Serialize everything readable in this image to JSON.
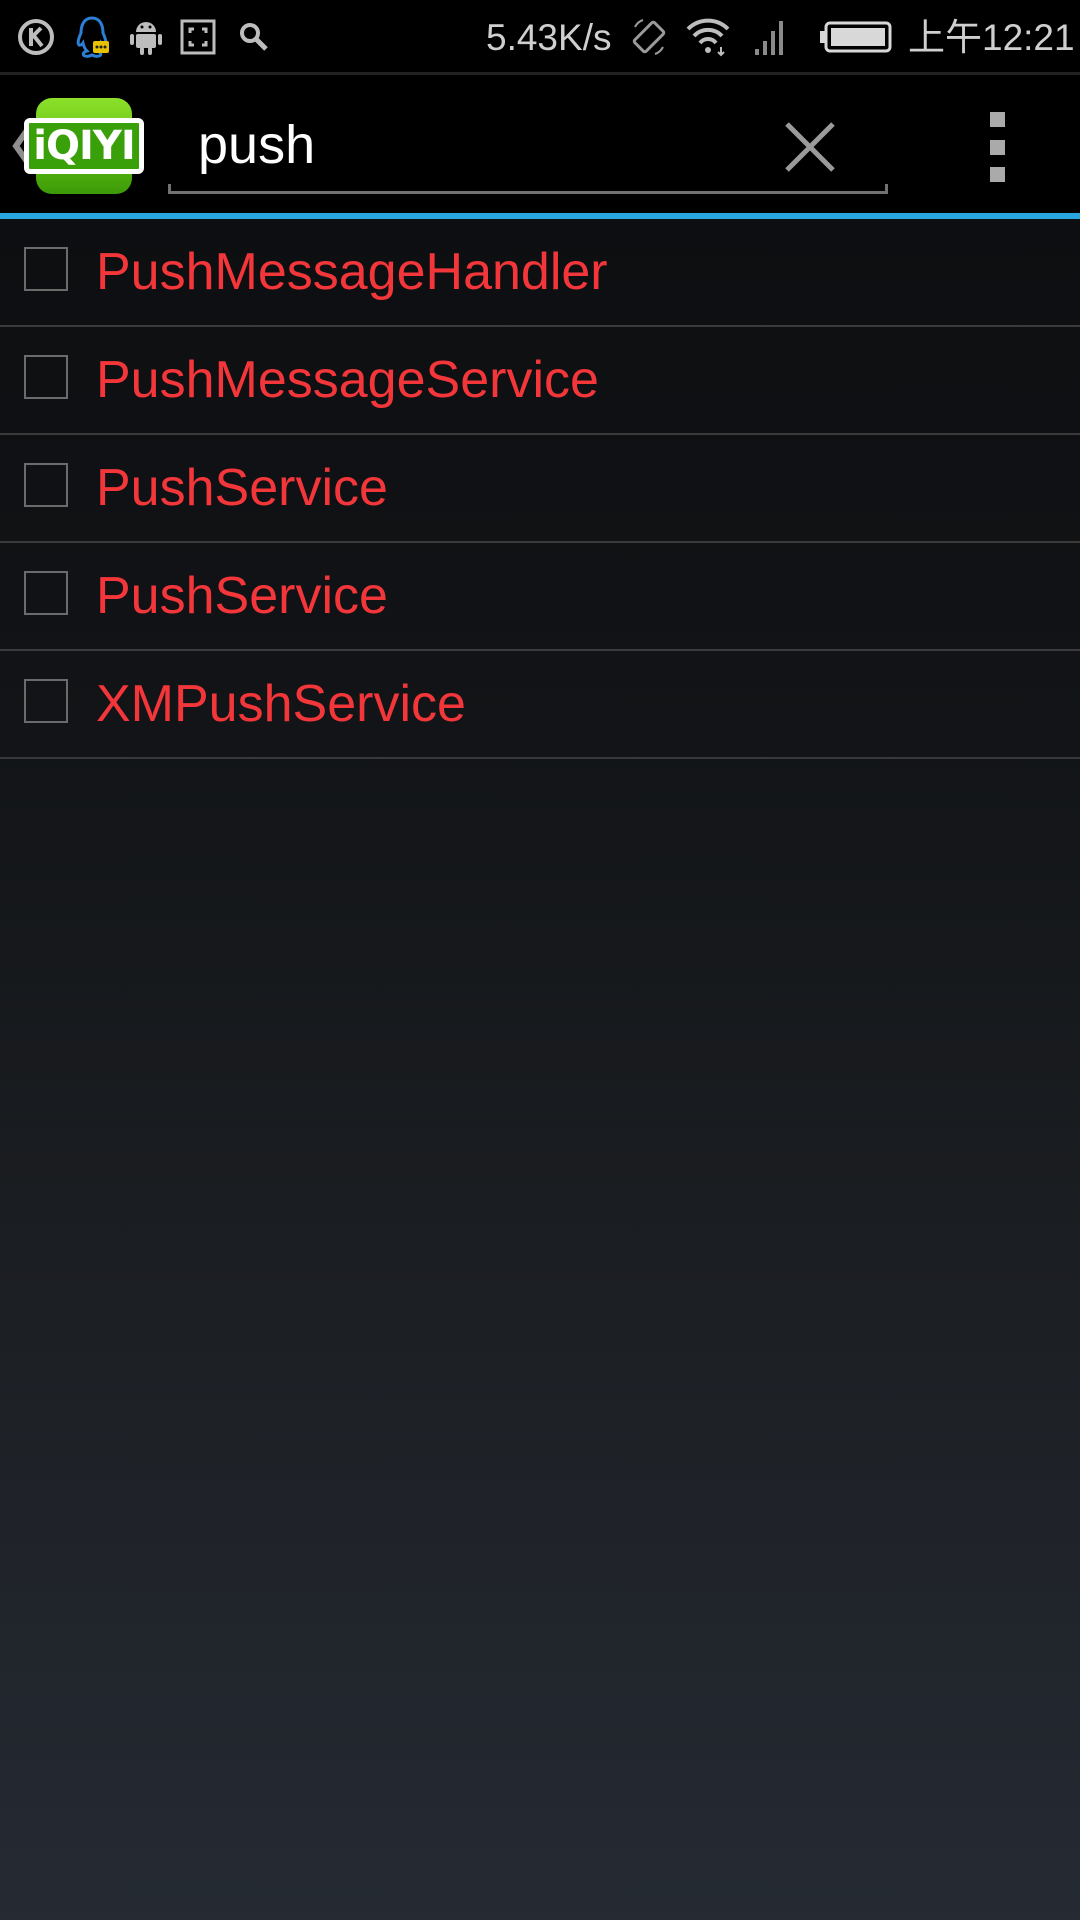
{
  "status_bar": {
    "network_speed": "5.43K/s",
    "time": "上午12:21",
    "icons": [
      "k-circle-icon",
      "qq-icon",
      "android-icon",
      "screenshot-icon",
      "search-icon",
      "rotate-icon",
      "wifi-icon",
      "signal-icon",
      "battery-icon"
    ]
  },
  "action_bar": {
    "app_logo_text": "iQIYI",
    "search": {
      "value": "push",
      "placeholder": ""
    },
    "accent_color": "#27a6e0"
  },
  "results": {
    "text_color": "#f2363a",
    "items": [
      {
        "label": "PushMessageHandler",
        "checked": false
      },
      {
        "label": "PushMessageService",
        "checked": false
      },
      {
        "label": "PushService",
        "checked": false
      },
      {
        "label": "PushService",
        "checked": false
      },
      {
        "label": "XMPushService",
        "checked": false
      }
    ]
  }
}
